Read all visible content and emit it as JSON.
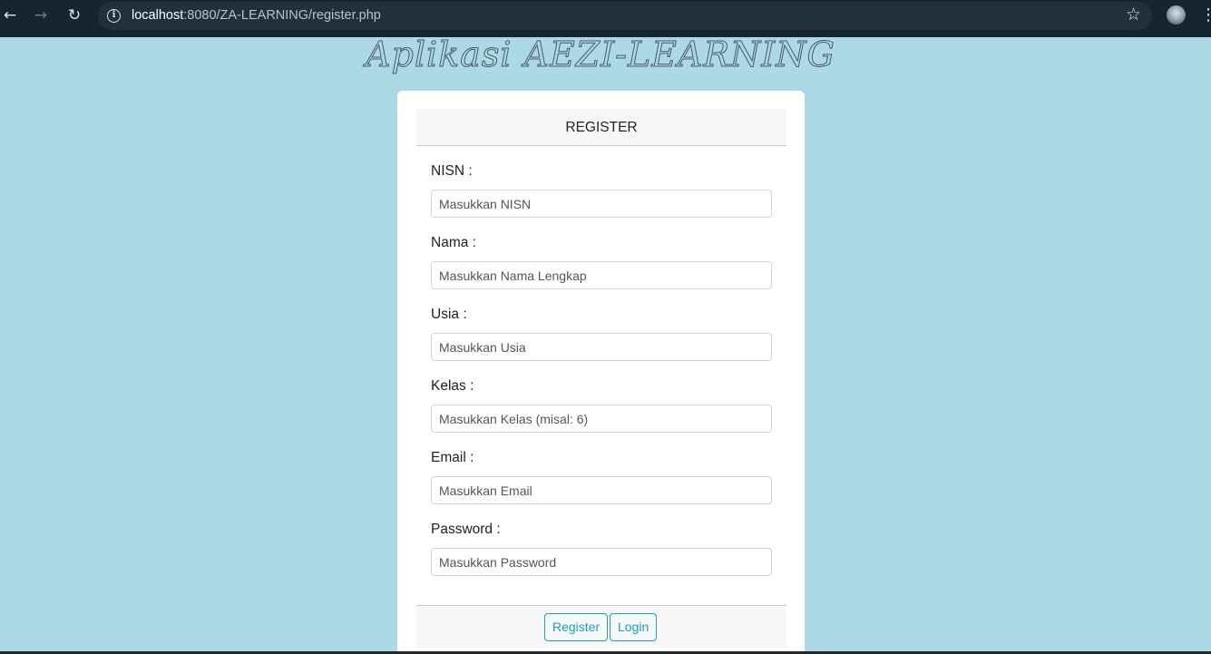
{
  "browser": {
    "url_host": "localhost",
    "url_rest": ":8080/ZA-LEARNING/register.php",
    "icons": {
      "back": "arrow-left-icon",
      "forward": "arrow-right-icon",
      "reload": "reload-icon",
      "info": "info-icon",
      "bookmark": "star-icon",
      "profile": "avatar",
      "menu": "kebab-menu-icon"
    }
  },
  "page": {
    "app_title": "Aplikasi AEZI-LEARNING",
    "background_color": "#add8e6",
    "accent_color": "#17a2b8"
  },
  "form": {
    "header": "REGISTER",
    "fields": [
      {
        "label": "NISN :",
        "placeholder": "Masukkan NISN"
      },
      {
        "label": "Nama :",
        "placeholder": "Masukkan Nama Lengkap"
      },
      {
        "label": "Usia :",
        "placeholder": "Masukkan Usia"
      },
      {
        "label": "Kelas :",
        "placeholder": "Masukkan Kelas (misal: 6)"
      },
      {
        "label": "Email :",
        "placeholder": "Masukkan Email"
      },
      {
        "label": "Password :",
        "placeholder": "Masukkan Password"
      }
    ],
    "register_label": "Register",
    "login_label": "Login"
  }
}
